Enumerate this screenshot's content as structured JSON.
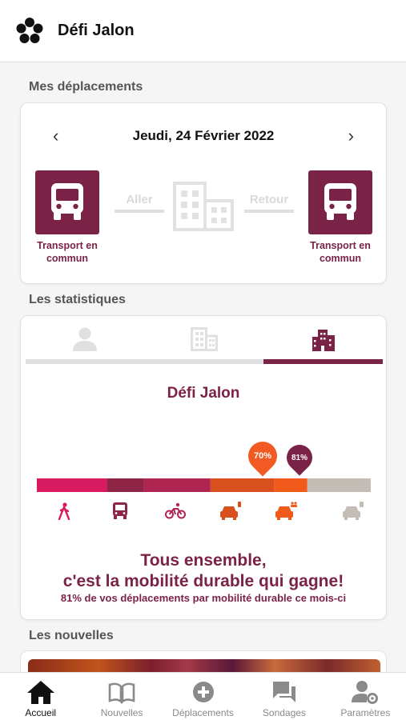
{
  "header": {
    "title": "Défi Jalon",
    "logo_icon": "flower-logo-icon"
  },
  "trips": {
    "section_label": "Mes déplacements",
    "date": "Jeudi, 24 Février 2022",
    "prev_icon": "chevron-left-icon",
    "next_icon": "chevron-right-icon",
    "outbound_label": "Aller",
    "return_label": "Retour",
    "outbound_mode": "Transport en commun",
    "return_mode": "Transport en commun",
    "mode_icon": "bus-icon",
    "destination_icon": "building-icon"
  },
  "stats": {
    "section_label": "Les statistiques",
    "tabs": [
      {
        "icon": "person-icon",
        "active": false
      },
      {
        "icon": "building-icon",
        "active": false
      },
      {
        "icon": "city-icon",
        "active": true
      }
    ],
    "title": "Défi Jalon",
    "markers": [
      {
        "label": "70%",
        "value": 70,
        "color": "#f15a22"
      },
      {
        "label": "81%",
        "value": 81,
        "color": "#7b2347"
      }
    ],
    "segments": [
      {
        "mode": "walking",
        "share": 21,
        "color": "#d81b60"
      },
      {
        "mode": "bus",
        "share": 11,
        "color": "#8e2446"
      },
      {
        "mode": "bike",
        "share": 20,
        "color": "#ad2550"
      },
      {
        "mode": "car-electric",
        "share": 19,
        "color": "#d8501d"
      },
      {
        "mode": "carpool",
        "share": 10,
        "color": "#f05a1a"
      },
      {
        "mode": "car-solo",
        "share": 19,
        "color": "#c4bdb5"
      }
    ],
    "mode_icons": [
      "walking-icon",
      "bus-icon",
      "bike-icon",
      "electric-car-icon",
      "carpool-icon",
      "car-solo-icon"
    ],
    "headline_line1": "Tous ensemble,",
    "headline_line2": "c'est la mobilité durable qui gagne!",
    "summary": "81% de vos déplacements par mobilité durable ce mois-ci"
  },
  "news": {
    "section_label": "Les nouvelles"
  },
  "nav": [
    {
      "label": "Accueil",
      "icon": "home-icon",
      "active": true
    },
    {
      "label": "Nouvelles",
      "icon": "book-icon",
      "active": false
    },
    {
      "label": "Déplacements",
      "icon": "plus-circle-icon",
      "active": false
    },
    {
      "label": "Sondages",
      "icon": "chat-icon",
      "active": false
    },
    {
      "label": "Paramètres",
      "icon": "user-settings-icon",
      "active": false
    }
  ],
  "colors": {
    "accent": "#7b2347",
    "orange": "#f15a22",
    "inactive": "#8a8a8a"
  }
}
